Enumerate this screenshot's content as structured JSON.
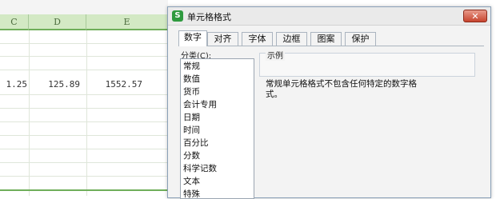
{
  "spreadsheet": {
    "columns": [
      "C",
      "D",
      "E"
    ],
    "row_values": [
      "1.25",
      "125.89",
      "1552.57"
    ]
  },
  "dialog": {
    "title": "单元格格式",
    "icon": "wps-s-icon",
    "close": "✕",
    "tabs": [
      "数字",
      "对齐",
      "字体",
      "边框",
      "图案",
      "保护"
    ],
    "active_tab": "数字",
    "category_label": "分类(C):",
    "categories": [
      "常规",
      "数值",
      "货币",
      "会计专用",
      "日期",
      "时间",
      "百分比",
      "分数",
      "科学记数",
      "文本",
      "特殊"
    ],
    "sample_label": "示例",
    "description": "常规单元格格式不包含任何特定的数字格式。"
  },
  "colors": {
    "header_bg": "#d3e9c4",
    "header_border": "#6fae5a",
    "close_red": "#c7442e"
  }
}
